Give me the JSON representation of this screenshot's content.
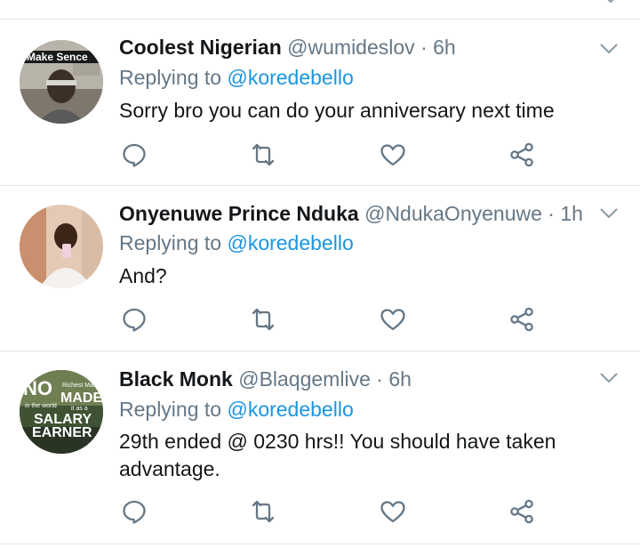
{
  "tweets": [
    {
      "name": "Coolest Nigerian",
      "handle": "@wumideslov",
      "separator": "·",
      "time": "6h",
      "replying_prefix": "Replying to ",
      "replying_to": "@koredebello",
      "text": "Sorry bro you can do your anniversary next time",
      "avatar_text": "Make Sence"
    },
    {
      "name": "Onyenuwe Prince Nduka",
      "handle": "@NdukaOnyenuwe",
      "separator": "·",
      "time": "1h",
      "replying_prefix": "Replying to ",
      "replying_to": "@koredebello",
      "text": "And?"
    },
    {
      "name": "Black Monk",
      "handle": "@Blaqgemlive",
      "separator": "·",
      "time": "6h",
      "replying_prefix": "Replying to ",
      "replying_to": "@koredebello",
      "text_line1": "29th ended @ 0230 hrs!! You should have taken",
      "text_line2": "advantage.",
      "avatar_text": {
        "line1": "NO",
        "small1": "Richest Man",
        "line2": "MADE",
        "small2": "in the world",
        "small3": "it as a",
        "line3": "SALARY",
        "line4": "EARNER"
      }
    }
  ],
  "colors": {
    "icon": "#657786",
    "link": "#1b95e0",
    "separator": "#e1e8ed",
    "text": "#14171a"
  },
  "icons": [
    "reply-icon",
    "retweet-icon",
    "like-icon",
    "share-icon",
    "chevron-down-icon"
  ]
}
